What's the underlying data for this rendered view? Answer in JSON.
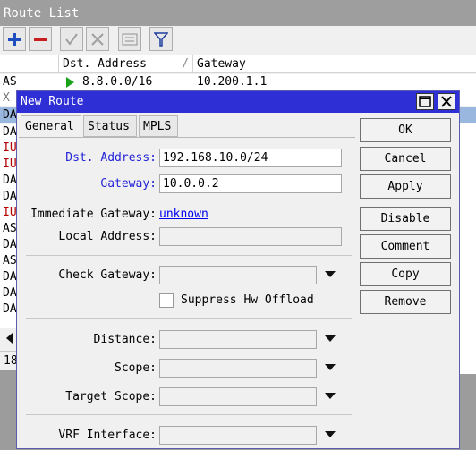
{
  "route_list": {
    "title": "Route List",
    "columns": {
      "dst": "Dst. Address",
      "gateway": "Gateway"
    },
    "rows": [
      {
        "flags": "AS",
        "dst": "8.8.0.0/16",
        "gateway": "10.200.1.1"
      },
      {
        "flags": "X",
        "dst": "",
        "gateway": ""
      },
      {
        "flags": "DA",
        "dst": "",
        "gateway": ""
      },
      {
        "flags": "DA",
        "dst": "",
        "gateway": ""
      },
      {
        "flags": "IU",
        "dst": "",
        "gateway": ""
      },
      {
        "flags": "IU",
        "dst": "",
        "gateway": ""
      },
      {
        "flags": "DA",
        "dst": "",
        "gateway": ""
      },
      {
        "flags": "DA",
        "dst": "",
        "gateway": ""
      },
      {
        "flags": "IU",
        "dst": "",
        "gateway": ""
      },
      {
        "flags": "AS",
        "dst": "",
        "gateway": ""
      },
      {
        "flags": "DA",
        "dst": "",
        "gateway": ""
      },
      {
        "flags": "AS",
        "dst": "",
        "gateway": ""
      },
      {
        "flags": "DA",
        "dst": "",
        "gateway": ""
      },
      {
        "flags": "DA",
        "dst": "",
        "gateway": ""
      },
      {
        "flags": "DA",
        "dst": "",
        "gateway": ""
      }
    ],
    "status_count": "18"
  },
  "dialog": {
    "title": "New Route",
    "tabs": [
      "General",
      "Status",
      "MPLS"
    ],
    "fields": {
      "dst_address": {
        "label": "Dst. Address:",
        "value": "192.168.10.0/24"
      },
      "gateway": {
        "label": "Gateway:",
        "value": "10.0.0.2"
      },
      "immediate_gateway": {
        "label": "Immediate Gateway:",
        "value": "unknown"
      },
      "local_address": {
        "label": "Local Address:",
        "value": ""
      },
      "check_gateway": {
        "label": "Check Gateway:",
        "value": ""
      },
      "suppress_hw_offload": {
        "label": "Suppress Hw Offload",
        "checked": false
      },
      "distance": {
        "label": "Distance:",
        "value": ""
      },
      "scope": {
        "label": "Scope:",
        "value": ""
      },
      "target_scope": {
        "label": "Target Scope:",
        "value": ""
      },
      "vrf_interface": {
        "label": "VRF Interface:",
        "value": ""
      }
    },
    "buttons": {
      "ok": "OK",
      "cancel": "Cancel",
      "apply": "Apply",
      "disable": "Disable",
      "comment": "Comment",
      "copy": "Copy",
      "remove": "Remove"
    }
  },
  "colors": {
    "dialog_title_bg": "#2f2fd6",
    "label_blue": "#2323d8",
    "selected_row": "#9ab8df",
    "invalid_flag": "#b40000",
    "add_icon": "#1f4fbf",
    "remove_icon": "#c81e1e"
  }
}
